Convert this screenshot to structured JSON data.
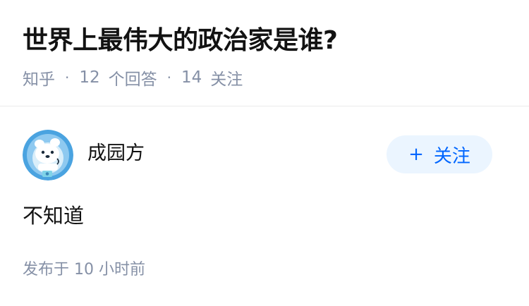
{
  "question": {
    "title": "世界上最伟大的政治家是谁?",
    "source": "知乎",
    "separator": "·",
    "answer_count": "12",
    "answer_label": "个回答",
    "follow_count": "14",
    "follow_label": "关注"
  },
  "answer": {
    "author_name": "成园方",
    "follow_button": {
      "icon": "plus-icon",
      "symbol": "+",
      "label": "关注"
    },
    "avatar_icon": "avatar-bear-icon",
    "content": "不知道",
    "time_text": "发布于  10 小时前"
  },
  "colors": {
    "title": "#121212",
    "meta": "#8590a6",
    "accent": "#0066ff",
    "follow_bg": "#ebf5ff",
    "divider": "#ebebeb",
    "avatar_bg": "#4aa3e0"
  }
}
